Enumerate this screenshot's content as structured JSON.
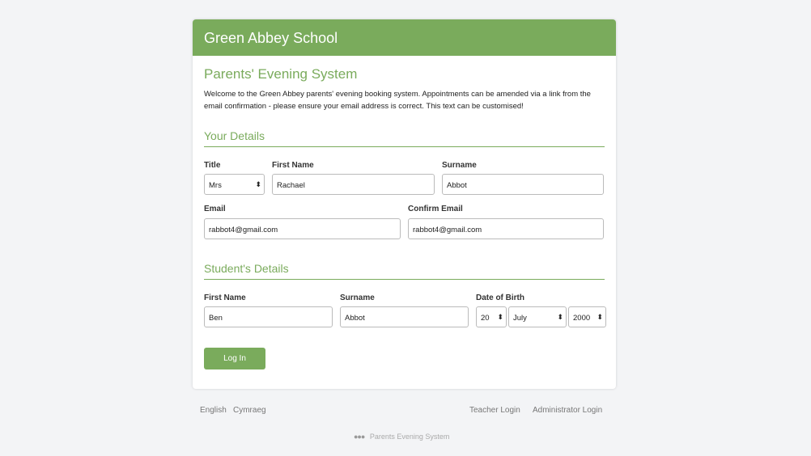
{
  "header": {
    "school": "Green Abbey School"
  },
  "main": {
    "title": "Parents' Evening System",
    "intro": "Welcome to the Green Abbey parents' evening booking system. Appointments can be amended via a link from the email confirmation - please ensure your email address is correct. This text can be customised!",
    "your_details": {
      "heading": "Your Details",
      "title_label": "Title",
      "title_value": "Mrs",
      "first_label": "First Name",
      "first_value": "Rachael",
      "surname_label": "Surname",
      "surname_value": "Abbot",
      "email_label": "Email",
      "email_value": "rabbot4@gmail.com",
      "confirm_label": "Confirm Email",
      "confirm_value": "rabbot4@gmail.com"
    },
    "student": {
      "heading": "Student's Details",
      "first_label": "First Name",
      "first_value": "Ben",
      "surname_label": "Surname",
      "surname_value": "Abbot",
      "dob_label": "Date of Birth",
      "day": "20",
      "month": "July",
      "year": "2000"
    },
    "login": "Log In"
  },
  "footer": {
    "english": "English",
    "welsh": "Cymraeg",
    "teacher": "Teacher Login",
    "admin": "Administrator Login",
    "brand": "Parents Evening System",
    "brand_icon": "people-icon"
  }
}
